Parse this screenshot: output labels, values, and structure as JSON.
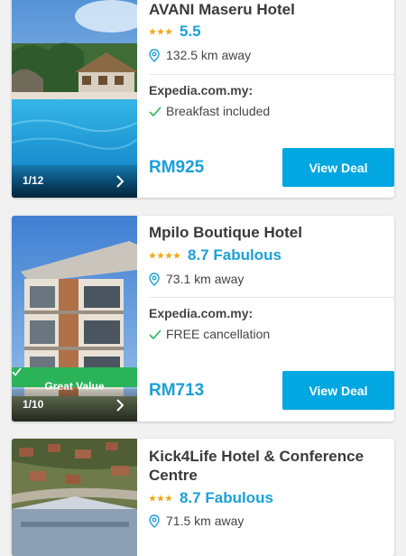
{
  "hotels": [
    {
      "name": "AVANI Maseru Hotel",
      "star_count": 3,
      "rating": "5.5",
      "distance": "132.5 km away",
      "provider": "Expedia.com.my:",
      "perk": "Breakfast included",
      "price": "RM925",
      "deal_label": "View Deal",
      "photo_counter": "1/12",
      "photo_icon": "next-chevron-icon"
    },
    {
      "name": "Mpilo Boutique Hotel",
      "star_count": 4,
      "rating": "8.7 Fabulous",
      "distance": "73.1 km away",
      "provider": "Expedia.com.my:",
      "perk": "FREE cancellation",
      "price": "RM713",
      "deal_label": "View Deal",
      "photo_counter": "1/10",
      "badge": "Great Value",
      "photo_icon": "next-chevron-icon"
    },
    {
      "name": "Kick4Life Hotel & Conference Centre",
      "star_count": 3,
      "rating": "8.7 Fabulous",
      "distance": "71.5 km away"
    }
  ],
  "colors": {
    "accent": "#1aa0d8",
    "button": "#00a7e1",
    "star": "#f3a712",
    "badge": "#2bb35a",
    "check": "#2bb35a"
  },
  "icons": [
    "star-icon",
    "location-pin-icon",
    "check-icon",
    "next-chevron-icon"
  ]
}
